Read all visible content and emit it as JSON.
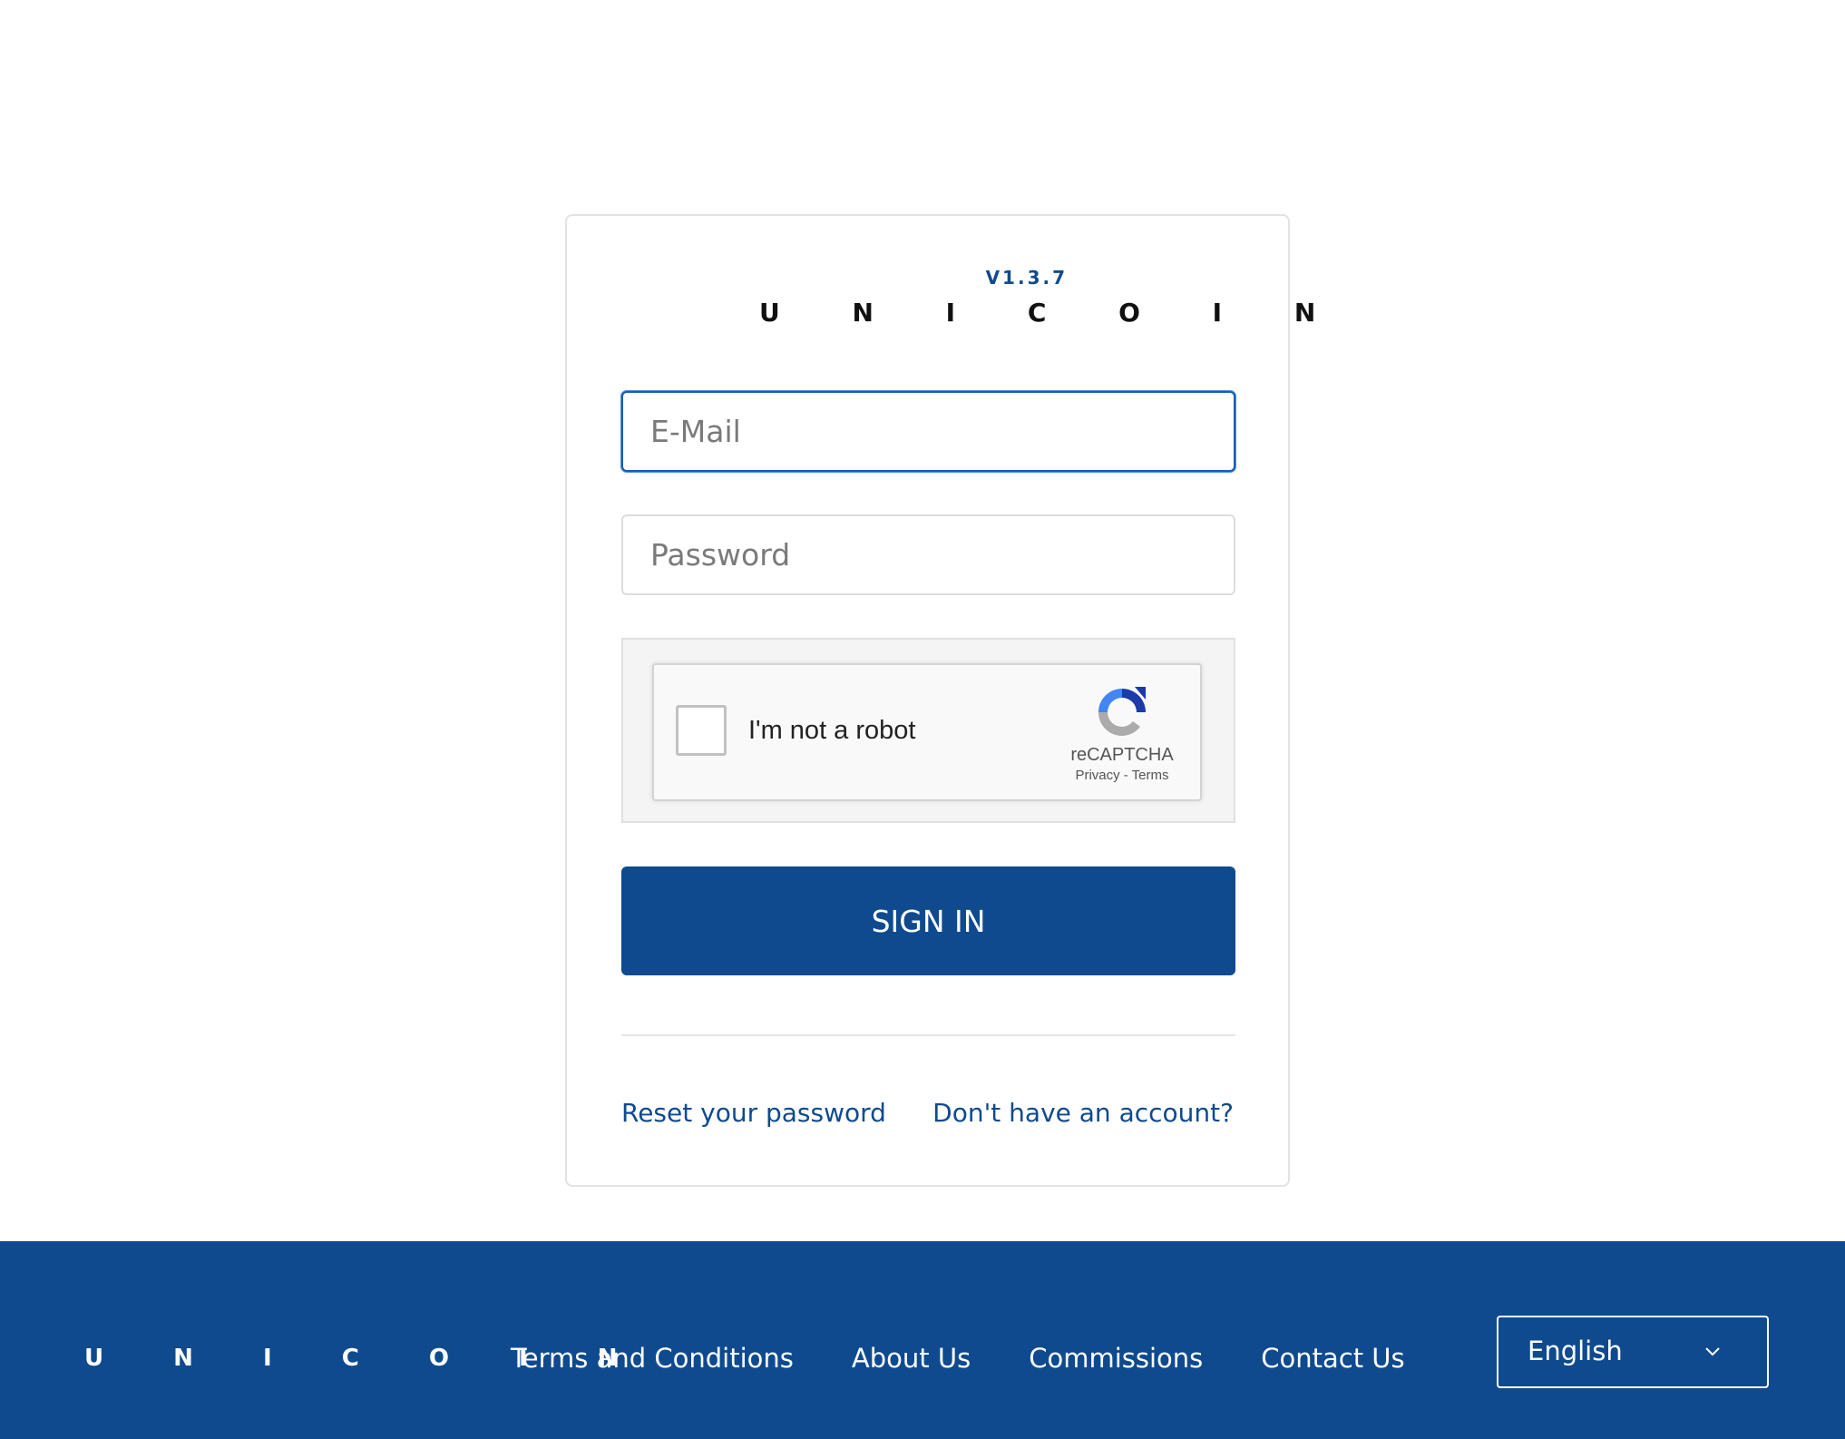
{
  "brand": {
    "name": "U N I C O I N",
    "version": "V1.3.7"
  },
  "login": {
    "email_placeholder": "E-Mail",
    "email_value": "",
    "password_placeholder": "Password",
    "password_value": "",
    "captcha": {
      "label": "I'm not a robot",
      "brand": "reCAPTCHA",
      "links": "Privacy - Terms",
      "checked": false
    },
    "signin_label": "SIGN IN",
    "reset_label": "Reset your password",
    "signup_label": "Don't have an account?"
  },
  "footer": {
    "logo": "U N I C O I N",
    "links": [
      "Terms and Conditions",
      "About Us",
      "Commissions",
      "Contact Us"
    ],
    "language": "English"
  },
  "colors": {
    "primary": "#0f4a8f",
    "focus_border": "#1a5cb0"
  },
  "icons": {
    "captcha_logo": "recaptcha-icon",
    "language_chevron": "chevron-down-icon"
  }
}
